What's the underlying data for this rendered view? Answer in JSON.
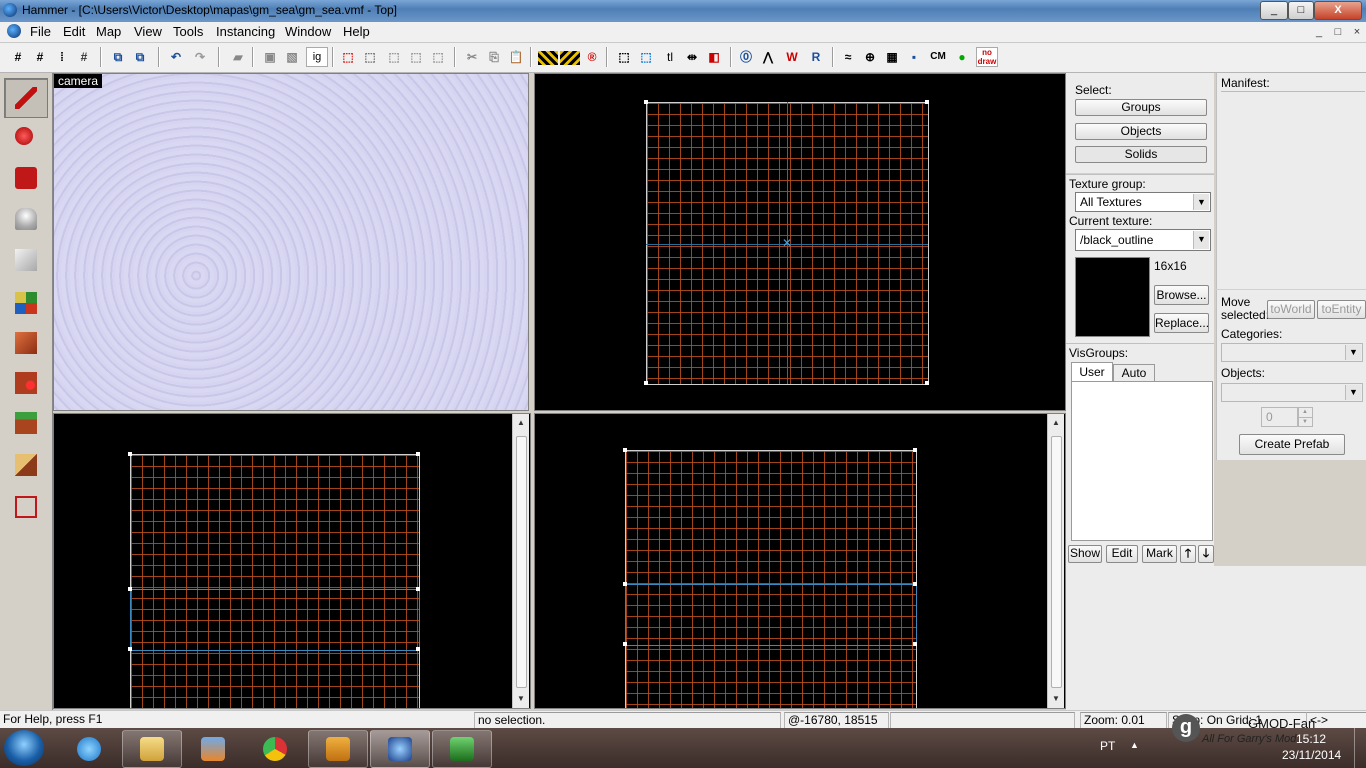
{
  "window": {
    "title": "Hammer - [C:\\Users\\Victor\\Desktop\\mapas\\gm_sea\\gm_sea.vmf - Top]",
    "controls": [
      "_",
      "□",
      "X"
    ]
  },
  "menu": {
    "items": [
      "File",
      "Edit",
      "Map",
      "View",
      "Tools",
      "Instancing",
      "Window",
      "Help"
    ],
    "mdi_controls": [
      "_",
      "□",
      "×"
    ]
  },
  "toolbar": {
    "ig_label": "ig",
    "tl_label": "tl",
    "cm_label": "CM",
    "nodraw_label": "no draw"
  },
  "tools": [
    "selection-tool",
    "magnify-tool",
    "camera-tool",
    "entity-tool",
    "block-tool",
    "texture-application-tool",
    "apply-current-texture-tool",
    "decal-tool",
    "overlay-tool",
    "clipping-tool",
    "vertex-tool"
  ],
  "viewports": {
    "camera_label": "camera"
  },
  "select_panel": {
    "label": "Select:",
    "buttons": [
      "Groups",
      "Objects",
      "Solids"
    ]
  },
  "texture_panel": {
    "group_label": "Texture group:",
    "group_value": "All Textures",
    "current_label": "Current texture:",
    "current_value": "/black_outline",
    "size": "16x16",
    "browse": "Browse...",
    "replace": "Replace..."
  },
  "visgroups": {
    "label": "VisGroups:",
    "tabs": [
      "User",
      "Auto"
    ],
    "buttons": [
      "Show",
      "Edit",
      "Mark"
    ]
  },
  "manifest": {
    "label": "Manifest:"
  },
  "prefab_panel": {
    "move_label": "Move selected:",
    "to_world": "toWorld",
    "to_entity": "toEntity",
    "categories_label": "Categories:",
    "objects_label": "Objects:",
    "spin_value": "0",
    "create_prefab": "Create Prefab"
  },
  "status": {
    "help": "For Help, press F1",
    "selection": "no selection.",
    "coords": "@-16780, 18515",
    "zoom": "Zoom: 0.01",
    "snap": "Snap: On Grid: 1",
    "extra": "<->"
  },
  "taskbar": {
    "lang": "PT",
    "time": "15:12",
    "date": "23/11/2014",
    "overlay_title": "GMOD-Fan",
    "overlay_sub": "All For Garry's Mod",
    "overlay_logo": "g"
  },
  "colors": {
    "grid_line": "#be501e",
    "axis_line": "#2a6f9a",
    "camera_bg": "#d0cfee",
    "taskbar": "#4a3a35"
  }
}
